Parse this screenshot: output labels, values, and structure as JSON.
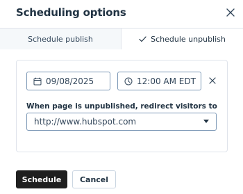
{
  "dialog": {
    "title": "Scheduling options",
    "close_icon": "close-icon"
  },
  "tabs": [
    {
      "label": "Schedule publish",
      "selected": false
    },
    {
      "label": "Schedule unpublish",
      "selected": true,
      "icon": "checkmark-icon"
    }
  ],
  "schedule": {
    "date": {
      "value": "09/08/2025",
      "icon": "calendar-icon"
    },
    "time": {
      "value": "12:00 AM EDT",
      "icon": "clock-icon"
    },
    "clear_icon": "close-icon"
  },
  "redirect": {
    "label": "When page is unpublished, redirect visitors to",
    "selected_value": "http://www.hubspot.com"
  },
  "footer": {
    "schedule_label": "Schedule",
    "cancel_label": "Cancel"
  },
  "colors": {
    "primary_button": "#1f1f1f",
    "border": "#dfe3eb",
    "input_border": "#7c98b6",
    "text": "#213343",
    "inactive_tab_bg": "#f5f8fa"
  }
}
